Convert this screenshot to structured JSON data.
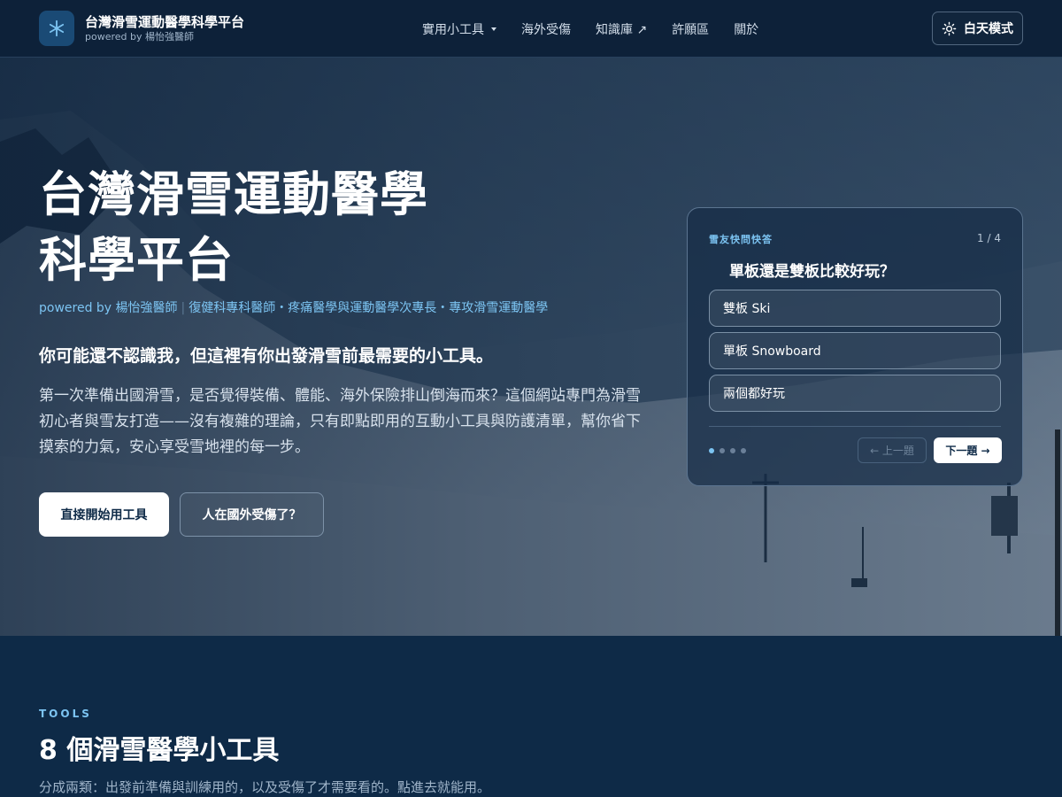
{
  "nav": {
    "brand_title": "台灣滑雪運動醫學科學平台",
    "brand_subtitle": "powered by 楊怡強醫師",
    "logo_icon": "snowflake-icon",
    "links": [
      {
        "label": "實用小工具",
        "dropdown": true
      },
      {
        "label": "海外受傷",
        "dropdown": false
      },
      {
        "label": "知識庫 ↗",
        "dropdown": false
      },
      {
        "label": "許願區",
        "dropdown": false
      },
      {
        "label": "關於",
        "dropdown": false
      }
    ],
    "theme_toggle_label": "白天模式",
    "theme_toggle_icon": "sun-icon"
  },
  "hero": {
    "title_line1": "台灣滑雪運動醫學",
    "title_line2": "科學平台",
    "byline_author": "powered by 楊怡強醫師",
    "byline_separator": "|",
    "byline_credentials": "復健科專科醫師・疼痛醫學與運動醫學次專長・專攻滑雪運動醫學",
    "lead": "你可能還不認識我，但這裡有你出發滑雪前最需要的小工具。",
    "description": "第一次準備出國滑雪，是否覺得裝備、體能、海外保險排山倒海而來？這個網站專門為滑雪初心者與雪友打造——沒有複雜的理論，只有即點即用的互動小工具與防護清單，幫你省下摸索的力氣，安心享受雪地裡的每一步。",
    "primary_button": "直接開始用工具",
    "secondary_button": "人在國外受傷了？"
  },
  "quiz": {
    "eyebrow": "雪友快問快答",
    "counter": "1 / 4",
    "question": "單板還是雙板比較好玩？",
    "options": [
      "雙板 Ski",
      "單板 Snowboard",
      "兩個都好玩"
    ],
    "total_steps": 4,
    "current_step": 1,
    "prev_label": "← 上一題",
    "next_label": "下一題 →"
  },
  "tools": {
    "eyebrow": "TOOLS",
    "title": "8 個滑雪醫學小工具",
    "description": "分成兩類：出發前準備與訓練用的，以及受傷了才需要看的。點進去就能用。"
  },
  "colors": {
    "navy": "#0e2a47",
    "nav_bg": "#0d2139",
    "accent_blue": "#7cc4f2",
    "white": "#ffffff"
  }
}
